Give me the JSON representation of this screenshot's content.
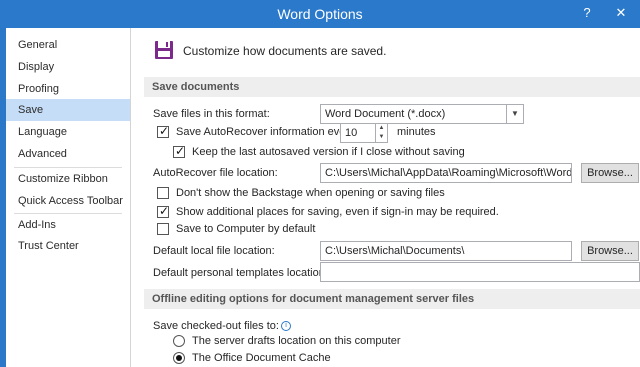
{
  "window": {
    "title": "Word Options",
    "help_glyph": "?",
    "close_glyph": "✕"
  },
  "sidebar": {
    "items": [
      {
        "label": "General"
      },
      {
        "label": "Display"
      },
      {
        "label": "Proofing"
      },
      {
        "label": "Save",
        "active": true
      },
      {
        "label": "Language"
      },
      {
        "label": "Advanced"
      },
      {
        "label": "Customize Ribbon"
      },
      {
        "label": "Quick Access Toolbar"
      },
      {
        "label": "Add-Ins"
      },
      {
        "label": "Trust Center"
      }
    ]
  },
  "header": {
    "text": "Customize how documents are saved.",
    "icon": "save-disk-icon"
  },
  "save_documents": {
    "section_title": "Save documents",
    "format_label": "Save files in this format:",
    "format_value": "Word Document (*.docx)",
    "autorecover_label": "Save AutoRecover information every",
    "autorecover_checked": true,
    "autorecover_minutes": "10",
    "minutes_label": "minutes",
    "keep_last_label": "Keep the last autosaved version if I close without saving",
    "keep_last_checked": true,
    "autorecover_location_label": "AutoRecover file location:",
    "autorecover_location_value": "C:\\Users\\Michal\\AppData\\Roaming\\Microsoft\\Word\\",
    "browse_label": "Browse...",
    "dont_show_backstage_label": "Don't show the Backstage when opening or saving files",
    "dont_show_backstage_checked": false,
    "show_additional_label": "Show additional places for saving, even if sign-in may be required.",
    "show_additional_checked": true,
    "save_to_computer_label": "Save to Computer by default",
    "save_to_computer_checked": false,
    "default_local_label": "Default local file location:",
    "default_local_value": "C:\\Users\\Michal\\Documents\\",
    "browse2_label": "Browse...",
    "personal_templates_label": "Default personal templates location:",
    "personal_templates_value": ""
  },
  "offline": {
    "section_title": "Offline editing options for document management server files",
    "checked_out_label": "Save checked-out files to:",
    "radio1_label": "The server drafts location on this computer",
    "radio1_selected": false,
    "radio2_label": "The Office Document Cache",
    "radio2_selected": true
  },
  "colors": {
    "title_bar": "#2a79cb",
    "active_sidebar": "#c5ddf6",
    "section_bg": "#eeeeee",
    "save_icon": "#7b2a8c"
  }
}
